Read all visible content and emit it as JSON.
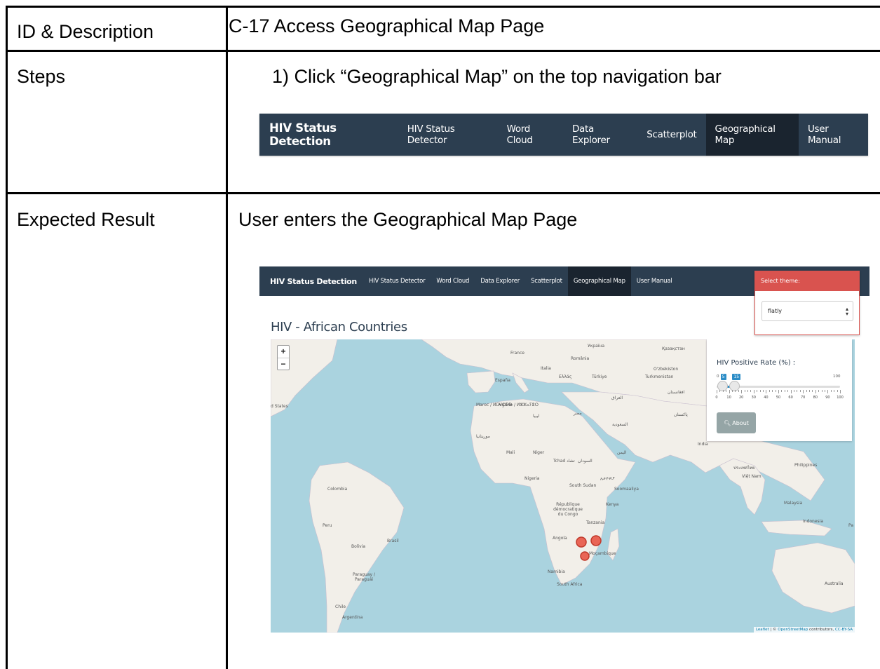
{
  "table": {
    "row1_label": "ID & Description",
    "row1_value": "C-17 Access Geographical Map Page",
    "row2_label": "Steps",
    "row2_value": "1)  Click  “Geographical Map” on the top navigation bar",
    "row3_label": "Expected Result",
    "row3_value": "User enters the Geographical Map Page"
  },
  "navbar": {
    "brand": "HIV Status Detection",
    "items": [
      "HIV Status Detector",
      "Word Cloud",
      "Data Explorer",
      "Scatterplot",
      "Geographical Map",
      "User Manual"
    ],
    "active_index": 4
  },
  "theme": {
    "title": "Select theme:",
    "selected": "flatly"
  },
  "page": {
    "title": "HIV - African Countries"
  },
  "controls": {
    "label": "HIV Positive Rate (%) :",
    "min": "0",
    "max": "100",
    "from_value": 5,
    "to_value": 15,
    "tick_labels": [
      "0",
      "10",
      "20",
      "30",
      "40",
      "50",
      "60",
      "70",
      "80",
      "90",
      "100"
    ],
    "about_label": "About"
  },
  "map": {
    "zoom_in": "+",
    "zoom_out": "−",
    "attribution_leaflet": "Leaflet",
    "attribution_sep": " | © ",
    "attribution_osm": "OpenStreetMap",
    "attribution_mid": " contributors, ",
    "attribution_cc": "CC-BY-SA",
    "labels": [
      "France",
      "Україна",
      "România",
      "Қазақстан",
      "Italia",
      "Ελλάς",
      "Türkiye",
      "España",
      "O'zbekiston",
      "Turkmenistan",
      "العراق",
      "افغانستان",
      "پاکستان",
      "Maroc / ⵍⵎⵖⵔⵉⴱ",
      "Algérie / ⵍⵣⵣⴰⵢⴻⵔ",
      "ليبيا",
      "مصر",
      "السعودية",
      "موريتانيا",
      "Mali",
      "Niger",
      "Tchad تشاد",
      "السودان",
      "اليمن",
      "India",
      "Nigeria",
      "South Sudan",
      "ኢትዮጵያ",
      "Soomaaliya",
      "République démocratique du Congo",
      "Kenya",
      "Tanzania",
      "Angola",
      "Moçambique",
      "Namibia",
      "South Africa",
      "Colombia",
      "Peru",
      "Brasil",
      "Bolivia",
      "Paraguay / Paraguái",
      "Chile",
      "Argentina",
      "Việt Nam",
      "Philippines",
      "Malaysia",
      "Indonesia",
      "Australia",
      "d States",
      "ประเทศไทย",
      "Pa"
    ]
  },
  "colors": {
    "navbar": "#2c3e50",
    "navbar_active": "#1a242f",
    "theme_header": "#d9534f",
    "slider": "#2c8dc7",
    "about_button": "#95a5a6",
    "water": "#aad3df",
    "land": "#f2efe9",
    "marker": "#e74c3c"
  }
}
